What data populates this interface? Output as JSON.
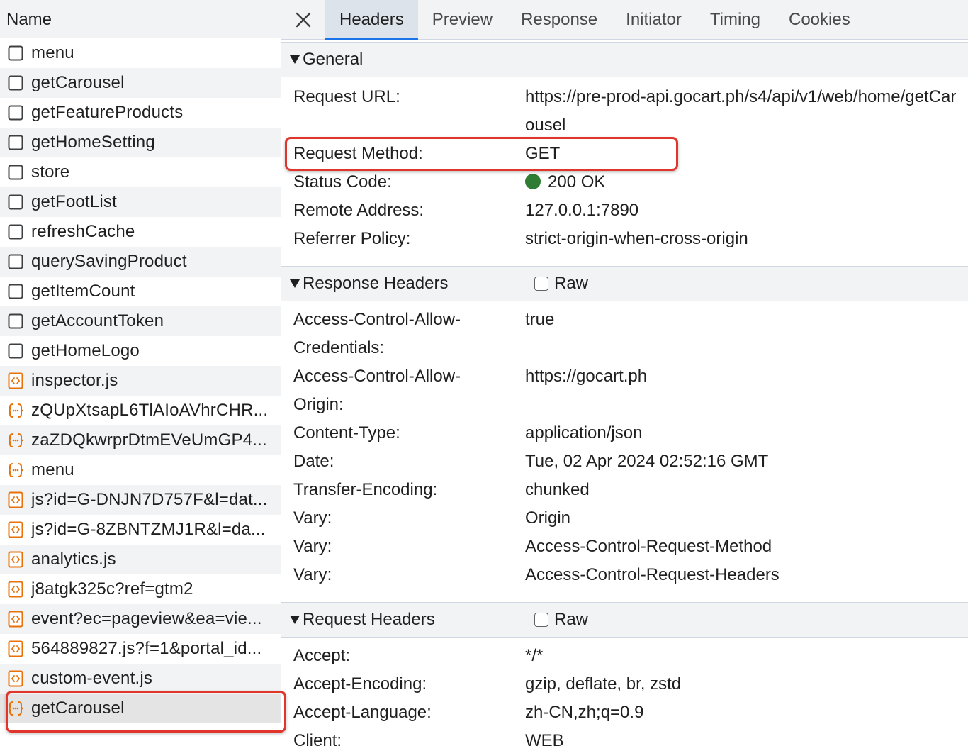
{
  "left_panel": {
    "column_header": "Name",
    "requests": [
      {
        "name": "menu",
        "icon": "checkbox-icon"
      },
      {
        "name": "getCarousel",
        "icon": "checkbox-icon"
      },
      {
        "name": "getFeatureProducts",
        "icon": "checkbox-icon"
      },
      {
        "name": "getHomeSetting",
        "icon": "checkbox-icon"
      },
      {
        "name": "store",
        "icon": "checkbox-icon"
      },
      {
        "name": "getFootList",
        "icon": "checkbox-icon"
      },
      {
        "name": "refreshCache",
        "icon": "checkbox-icon"
      },
      {
        "name": "querySavingProduct",
        "icon": "checkbox-icon"
      },
      {
        "name": "getItemCount",
        "icon": "checkbox-icon"
      },
      {
        "name": "getAccountToken",
        "icon": "checkbox-icon"
      },
      {
        "name": "getHomeLogo",
        "icon": "checkbox-icon"
      },
      {
        "name": "inspector.js",
        "icon": "script-file-icon"
      },
      {
        "name": "zQUpXtsapL6TlAIoAVhrCHR...",
        "icon": "json-braces-icon"
      },
      {
        "name": "zaZDQkwrprDtmEVeUmGP4...",
        "icon": "json-braces-icon"
      },
      {
        "name": "menu",
        "icon": "json-braces-icon"
      },
      {
        "name": "js?id=G-DNJN7D757F&l=dat...",
        "icon": "script-file-icon"
      },
      {
        "name": "js?id=G-8ZBNTZMJ1R&l=da...",
        "icon": "script-file-icon"
      },
      {
        "name": "analytics.js",
        "icon": "script-file-icon"
      },
      {
        "name": "j8atgk325c?ref=gtm2",
        "icon": "script-file-icon"
      },
      {
        "name": "event?ec=pageview&ea=vie...",
        "icon": "script-file-icon"
      },
      {
        "name": "564889827.js?f=1&portal_id...",
        "icon": "script-file-icon"
      },
      {
        "name": "custom-event.js",
        "icon": "script-file-icon"
      },
      {
        "name": "getCarousel",
        "icon": "json-braces-icon",
        "selected": true
      }
    ]
  },
  "tabs": [
    "Headers",
    "Preview",
    "Response",
    "Initiator",
    "Timing",
    "Cookies"
  ],
  "active_tab": "Headers",
  "general": {
    "title": "General",
    "rows": [
      {
        "key": "Request URL:",
        "value": "https://pre-prod-api.gocart.ph/s4/api/v1/web/home/getCarousel"
      },
      {
        "key": "Request Method:",
        "value": "GET"
      },
      {
        "key": "Status Code:",
        "value": "200 OK"
      },
      {
        "key": "Remote Address:",
        "value": "127.0.0.1:7890"
      },
      {
        "key": "Referrer Policy:",
        "value": "strict-origin-when-cross-origin"
      }
    ]
  },
  "response_headers": {
    "title": "Response Headers",
    "raw_label": "Raw",
    "rows": [
      {
        "key": "Access-Control-Allow-Credentials:",
        "value": "true"
      },
      {
        "key": "Access-Control-Allow-Origin:",
        "value": "https://gocart.ph"
      },
      {
        "key": "Content-Type:",
        "value": "application/json"
      },
      {
        "key": "Date:",
        "value": "Tue, 02 Apr 2024 02:52:16 GMT"
      },
      {
        "key": "Transfer-Encoding:",
        "value": "chunked"
      },
      {
        "key": "Vary:",
        "value": "Origin"
      },
      {
        "key": "Vary:",
        "value": "Access-Control-Request-Method"
      },
      {
        "key": "Vary:",
        "value": "Access-Control-Request-Headers"
      }
    ]
  },
  "request_headers": {
    "title": "Request Headers",
    "raw_label": "Raw",
    "rows": [
      {
        "key": "Accept:",
        "value": "*/*"
      },
      {
        "key": "Accept-Encoding:",
        "value": "gzip, deflate, br, zstd"
      },
      {
        "key": "Accept-Language:",
        "value": "zh-CN,zh;q=0.9"
      },
      {
        "key": "Client:",
        "value": "WEB"
      }
    ]
  },
  "colors": {
    "status_ok": "#2e7d32",
    "highlight_box": "#e0352b",
    "active_tab_underline": "#1a73e8",
    "resource_icon": "#e8710a"
  }
}
